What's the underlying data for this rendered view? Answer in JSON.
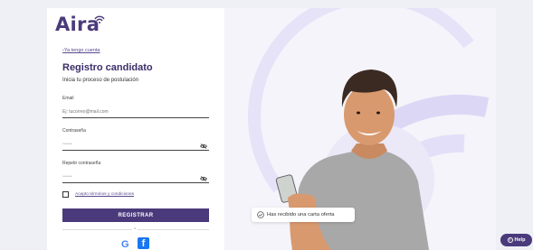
{
  "brand": {
    "name": "Aira",
    "color": "#4b3a7b"
  },
  "form": {
    "back_link": "Ya tengo cuenta",
    "title": "Registro candidato",
    "subtitle": "Inicia tu proceso de postulación",
    "email_label": "Email",
    "email_placeholder": "Ej: tucorreo@mail.com",
    "password_label": "Contraseña",
    "password_value": "••••••",
    "repeat_label": "Repetir contraseña",
    "repeat_value": "••••••",
    "terms_label": "Acepto términos y condiciones",
    "submit_label": "REGISTRAR",
    "or_text": "o"
  },
  "social": {
    "google": "G",
    "facebook": "f"
  },
  "hero": {
    "toast_text": "Has recibido una carta oferta",
    "person": "smiling-man-with-phone",
    "arc_color": "#c9c0ee",
    "background": "#f4f4fa"
  },
  "help": {
    "label": "Help"
  }
}
